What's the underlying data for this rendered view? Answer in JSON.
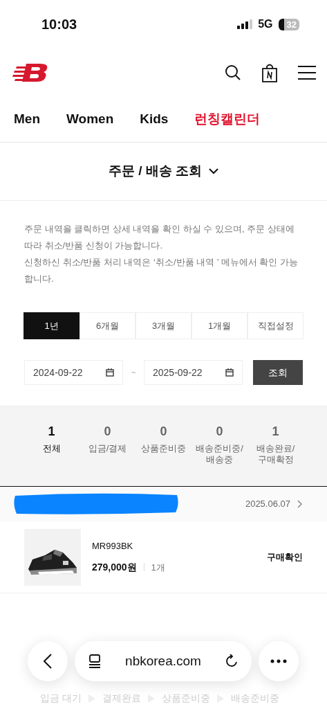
{
  "status_bar": {
    "time": "10:03",
    "network": "5G",
    "battery": "32"
  },
  "nav": [
    {
      "label": "Men",
      "kind": "plain"
    },
    {
      "label": "Women",
      "kind": "plain"
    },
    {
      "label": "Kids",
      "kind": "plain"
    },
    {
      "label": "런칭캘린더",
      "kind": "highlight"
    }
  ],
  "page_title": "주문 / 배송 조회",
  "notice": [
    "주문 내역을 클릭하면 상세 내역을 확인 하실 수 있으며, 주문 상태에 따라 취소/반품 신청이 가능합니다.",
    "신청하신 취소/반품 처리 내역은 ‘취소/반품 내역 ’ 메뉴에서 확인 가능합니다."
  ],
  "period_tabs": [
    {
      "label": "1년",
      "selected": true
    },
    {
      "label": "6개월",
      "selected": false
    },
    {
      "label": "3개월",
      "selected": false
    },
    {
      "label": "1개월",
      "selected": false
    },
    {
      "label": "직접설정",
      "selected": false
    }
  ],
  "date_from": "2024-09-22",
  "date_separator": "~",
  "date_to": "2025-09-22",
  "search_button": "조회",
  "summary": [
    {
      "count": "1",
      "label": "전체",
      "selected": true
    },
    {
      "count": "0",
      "label": "입금/결제",
      "selected": false
    },
    {
      "count": "0",
      "label": "상품준비중",
      "selected": false
    },
    {
      "count": "0",
      "label": "배송준비중/ 배송중",
      "selected": false
    },
    {
      "count": "1",
      "label": "배송완료/ 구매확정",
      "selected": false
    }
  ],
  "order": {
    "date": "2025.06.07",
    "product": {
      "name": "MR993BK",
      "price": "279,000원",
      "quantity": "1개",
      "status": "구매확인"
    }
  },
  "steps": [
    "입금 대기",
    "결제완료",
    "상품준비중",
    "배송준비중"
  ],
  "browser_bar": {
    "url": "nbkorea.com"
  }
}
